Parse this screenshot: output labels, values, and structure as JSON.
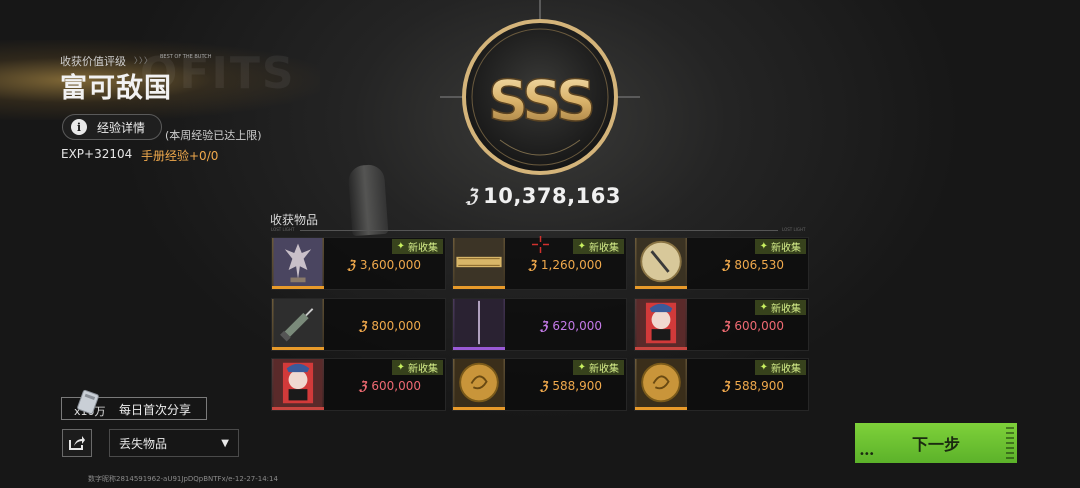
{
  "rating": {
    "label": "收获价值评级",
    "tier_marks": "〉〉〉",
    "badge_text": "BEST OF THE BUTCH",
    "title": "富可敌国",
    "grade": "SSS",
    "bg_ghost_text": "OFITS"
  },
  "exp": {
    "detail_button": "经验详情",
    "weekly_cap_note": "(本周经验已达上限)",
    "gain": "EXP+32104",
    "manual": "手册经验+0/0"
  },
  "total_value": "10,378,163",
  "items_section": {
    "title": "收获物品",
    "lost_left": "LOST LIGHT",
    "lost_right": "LOST LIGHT"
  },
  "items": [
    {
      "art": "statue",
      "quality": "gold",
      "new_label": "新收集",
      "value": "3,600,000",
      "value_color": "gold"
    },
    {
      "art": "bar",
      "quality": "gold",
      "new_label": "新收集",
      "value": "1,260,000",
      "value_color": "gold"
    },
    {
      "art": "plate",
      "quality": "gold",
      "new_label": "新收集",
      "value": "806,530",
      "value_color": "gold"
    },
    {
      "art": "syringe",
      "quality": "gold",
      "new_label": "",
      "value": "800,000",
      "value_color": "gold"
    },
    {
      "art": "rod",
      "quality": "purple",
      "new_label": "",
      "value": "620,000",
      "value_color": "purple"
    },
    {
      "art": "mask",
      "quality": "red",
      "new_label": "新收集",
      "value": "600,000",
      "value_color": "red"
    },
    {
      "art": "mask",
      "quality": "red",
      "new_label": "新收集",
      "value": "600,000",
      "value_color": "red"
    },
    {
      "art": "coin",
      "quality": "gold",
      "new_label": "新收集",
      "value": "588,900",
      "value_color": "gold"
    },
    {
      "art": "coin",
      "quality": "gold",
      "new_label": "新收集",
      "value": "588,900",
      "value_color": "gold"
    }
  ],
  "share": {
    "count": "x10万",
    "label": "每日首次分享"
  },
  "lost_items_select": "丢失物品",
  "next_button": "下一步",
  "footer_id": "数字昵称2814591962-aU91JpDQpBNTFx/e-12-27-14:14",
  "colors": {
    "gold": "#f0a94c",
    "purple": "#c37ae6",
    "red": "#ee6a72",
    "accent_green": "#6cc232"
  }
}
